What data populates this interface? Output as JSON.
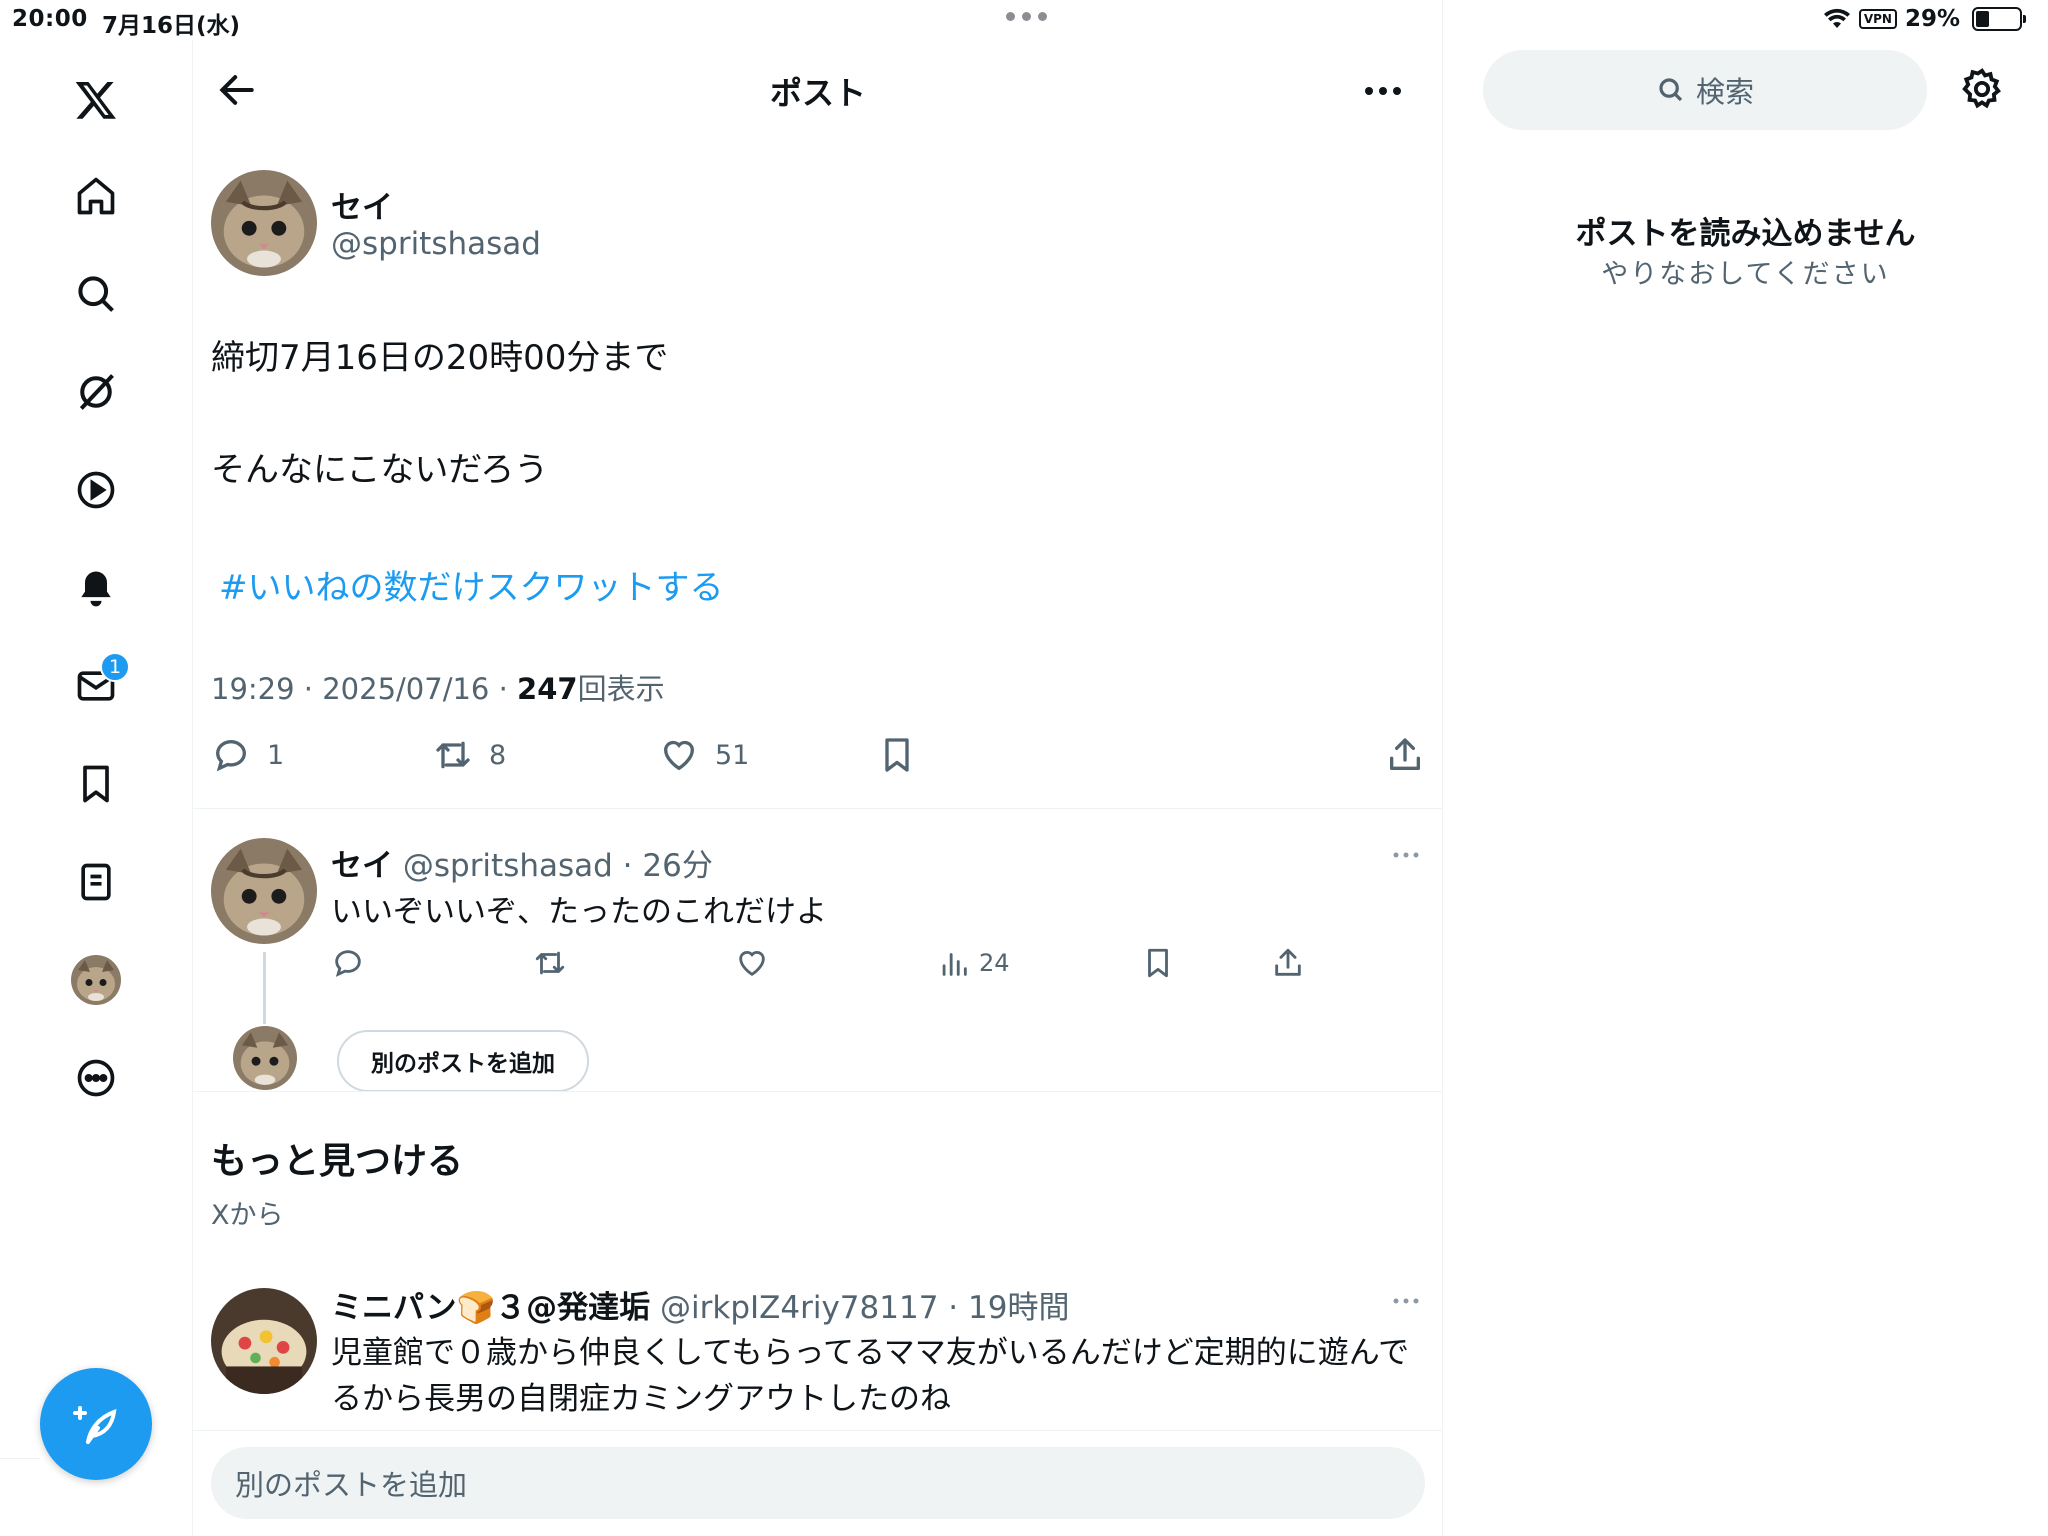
{
  "status_bar": {
    "time": "20:00",
    "date": "7月16日(水)",
    "vpn": "VPN",
    "battery": "29%"
  },
  "nav": {
    "items": [
      "x-logo",
      "home",
      "explore",
      "grok",
      "videos",
      "notifications",
      "messages",
      "bookmarks",
      "lists",
      "profile",
      "more"
    ],
    "messages_badge": "1"
  },
  "header": {
    "title": "ポスト"
  },
  "post": {
    "name": "セイ",
    "handle": "@spritshasad",
    "text_line1": "締切7月16日の20時00分まで",
    "text_line2": "そんなにこないだろう",
    "hashtag": "#いいねの数だけスクワットする",
    "time": "19:29",
    "date": "2025/07/16",
    "views": "247",
    "views_label": "回表示",
    "replies": "1",
    "reposts": "8",
    "likes": "51"
  },
  "reply": {
    "name": "セイ",
    "handle": "@spritshasad",
    "age": "26分",
    "text": "いいぞいいぞ、たったのこれだけよ",
    "views": "24",
    "add_post_label": "別のポストを追加"
  },
  "discover": {
    "title": "もっと見つける",
    "subtitle": "Xから"
  },
  "recommended": {
    "name": "ミニパン🍞３@発達垢",
    "handle": "@irkpIZ4riy78117",
    "age": "19時間",
    "text": "児童館で０歳から仲良くしてもらってるママ友がいるんだけど定期的に遊んでるから長男の自閉症カミングアウトしたのね"
  },
  "compose": {
    "placeholder": "別のポストを追加"
  },
  "right": {
    "search_placeholder": "検索",
    "error_title": "ポストを読み込めません",
    "error_subtitle": "やりなおしてください"
  },
  "colors": {
    "accent": "#1d9bf0",
    "text": "#0f1419",
    "muted": "#536471",
    "border": "#eff3f4"
  }
}
